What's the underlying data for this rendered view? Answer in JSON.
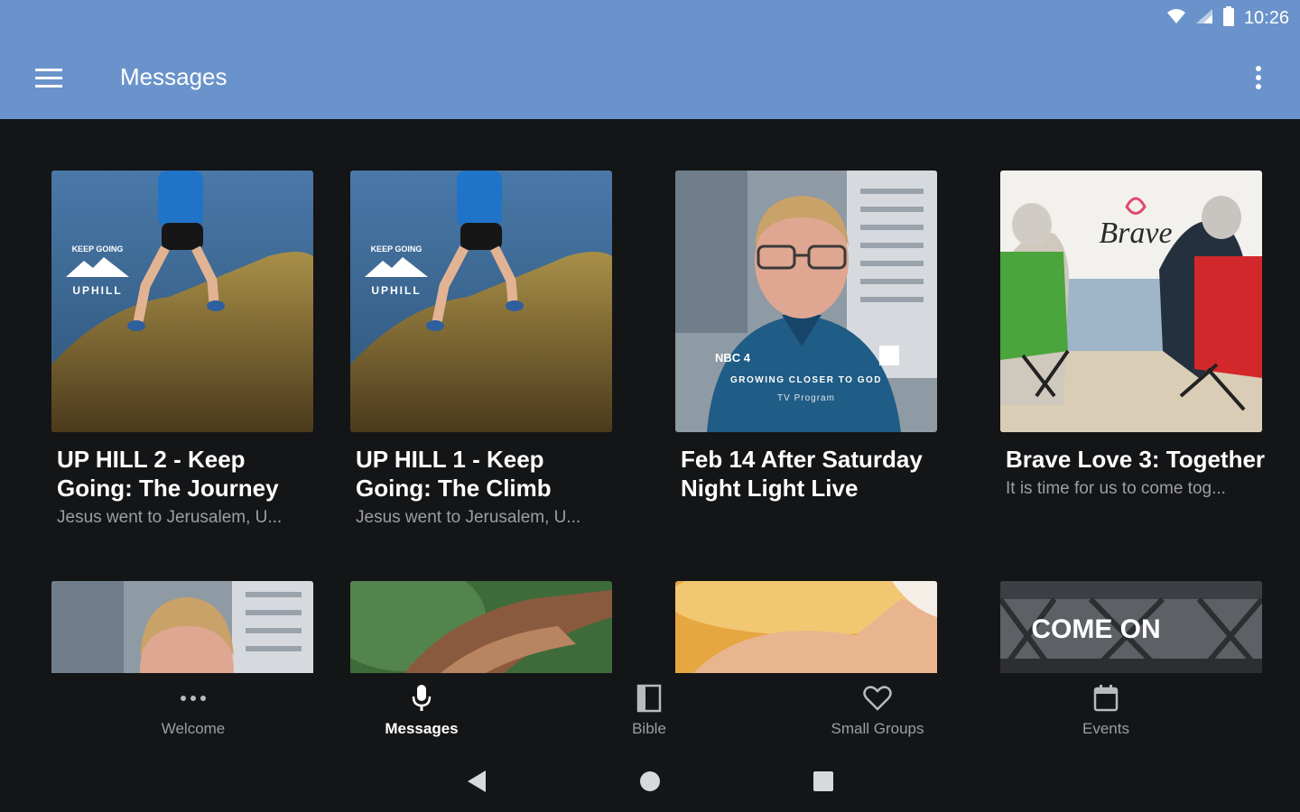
{
  "status_bar": {
    "time": "10:26"
  },
  "app_bar": {
    "title": "Messages"
  },
  "cards": [
    {
      "title": "UP HILL 2 - Keep Going: The Journey",
      "subtitle": "Jesus went to Jerusalem, U...",
      "logo_text": "UPHILL",
      "logo_arc": "KEEP GOING"
    },
    {
      "title": "UP HILL 1 - Keep Going: The Climb",
      "subtitle": "Jesus went to Jerusalem, U...",
      "logo_text": "UPHILL",
      "logo_arc": "KEEP GOING"
    },
    {
      "title": "Feb 14 After Saturday Night Light Live",
      "subtitle": "",
      "overlay_line1": "GROWING CLOSER TO GOD",
      "overlay_line2": "TV Program",
      "network": "NBC 4"
    },
    {
      "title": "Brave Love 3: Together",
      "subtitle": "It is time for us to come tog...",
      "script_text": "Brave"
    }
  ],
  "row2": [
    {
      "thumbnail": "city-man"
    },
    {
      "thumbnail": "hands"
    },
    {
      "thumbnail": "bread"
    },
    {
      "overlay_text": "COME ON"
    }
  ],
  "bottom_nav": [
    {
      "label": "Welcome",
      "icon": "more-horiz-icon",
      "active": false
    },
    {
      "label": "Messages",
      "icon": "microphone-icon",
      "active": true
    },
    {
      "label": "Bible",
      "icon": "book-icon",
      "active": false
    },
    {
      "label": "Small Groups",
      "icon": "heart-icon",
      "active": false
    },
    {
      "label": "Events",
      "icon": "calendar-icon",
      "active": false
    }
  ],
  "colors": {
    "app_bar": "#6a93cb",
    "background": "#141517",
    "subtitle": "#9c9ea2"
  }
}
